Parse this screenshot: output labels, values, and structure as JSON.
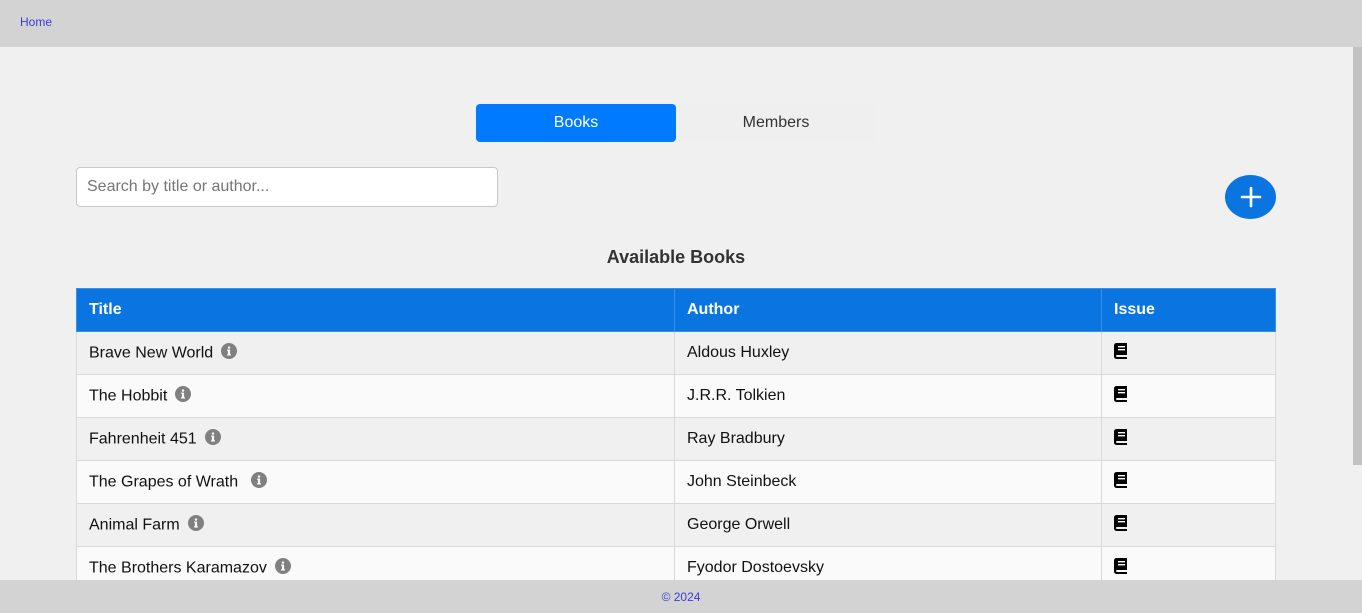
{
  "nav": {
    "home_label": "Home"
  },
  "tabs": [
    {
      "label": "Books",
      "active": true
    },
    {
      "label": "Members",
      "active": false
    }
  ],
  "search": {
    "placeholder": "Search by title or author...",
    "value": ""
  },
  "add_button": {
    "icon": "plus-icon"
  },
  "section_title": "Available Books",
  "table": {
    "headers": [
      "Title",
      "Author",
      "Issue"
    ],
    "rows": [
      {
        "title": "Brave New World",
        "author": "Aldous Huxley"
      },
      {
        "title": "The Hobbit",
        "author": "J.R.R. Tolkien"
      },
      {
        "title": "Fahrenheit 451",
        "author": "Ray Bradbury"
      },
      {
        "title": "The Grapes of Wrath ",
        "author": "John Steinbeck"
      },
      {
        "title": "Animal Farm",
        "author": "George Orwell"
      },
      {
        "title": "The Brothers Karamazov",
        "author": "Fyodor Dostoevsky"
      }
    ]
  },
  "footer": {
    "text": "© 2024"
  },
  "colors": {
    "primary": "#007bff",
    "header": "#0a74e0",
    "link": "#3b3bd6"
  }
}
